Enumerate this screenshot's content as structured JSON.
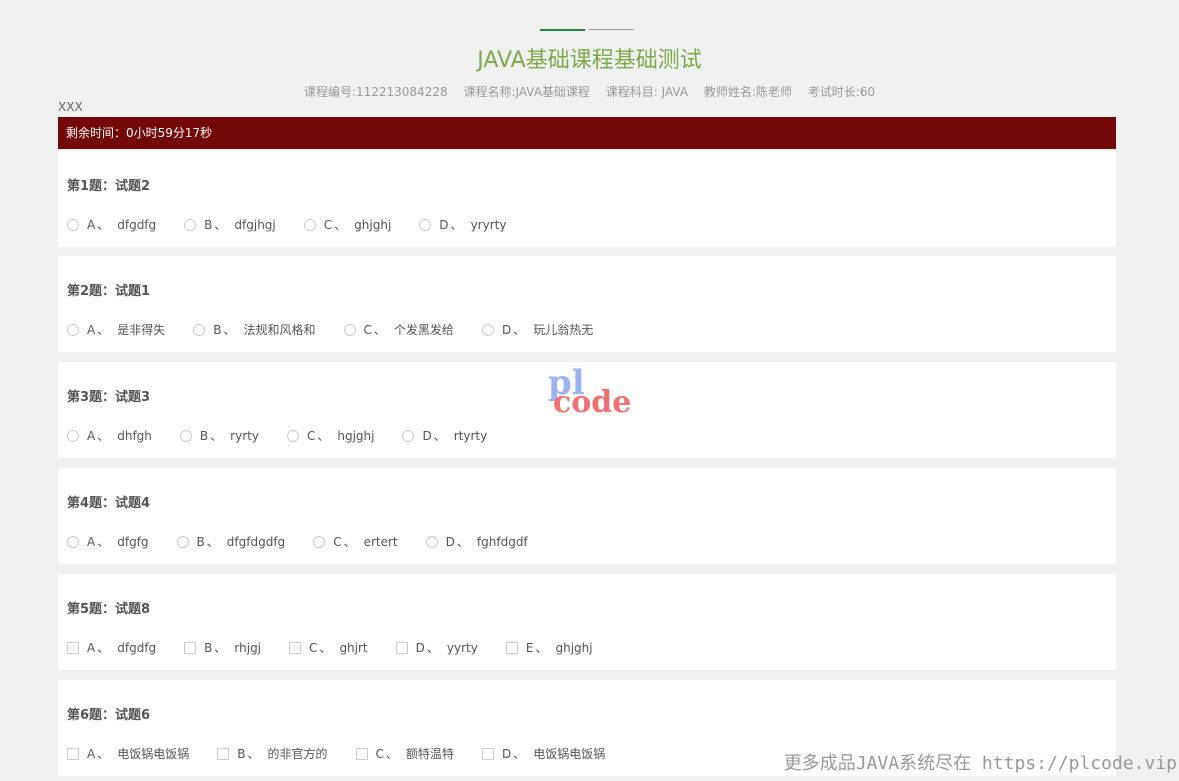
{
  "header": {
    "title": "JAVA基础课程基础测试",
    "meta": [
      "课程编号:112213084228",
      "课程名称:JAVA基础课程",
      "课程科目: JAVA",
      "教师姓名:陈老师",
      "考试时长:60"
    ],
    "user": "XXX"
  },
  "timer": "剩余时间：0小时59分17秒",
  "questions": [
    {
      "title": "第1题：试题2",
      "type": "radio",
      "options": [
        {
          "letter": "A",
          "text": "dfgdfg"
        },
        {
          "letter": "B",
          "text": "dfgjhgj"
        },
        {
          "letter": "C",
          "text": "ghjghj"
        },
        {
          "letter": "D",
          "text": "yryrty"
        }
      ]
    },
    {
      "title": "第2题：试题1",
      "type": "radio",
      "options": [
        {
          "letter": "A",
          "text": "是非得失"
        },
        {
          "letter": "B",
          "text": "法规和风格和"
        },
        {
          "letter": "C",
          "text": "个发黑发给"
        },
        {
          "letter": "D",
          "text": "玩儿翁热无"
        }
      ]
    },
    {
      "title": "第3题：试题3",
      "type": "radio",
      "options": [
        {
          "letter": "A",
          "text": "dhfgh"
        },
        {
          "letter": "B",
          "text": "ryrty"
        },
        {
          "letter": "C",
          "text": "hgjghj"
        },
        {
          "letter": "D",
          "text": "rtyrty"
        }
      ]
    },
    {
      "title": "第4题：试题4",
      "type": "radio",
      "options": [
        {
          "letter": "A",
          "text": "dfgfg"
        },
        {
          "letter": "B",
          "text": "dfgfdgdfg"
        },
        {
          "letter": "C",
          "text": "ertert"
        },
        {
          "letter": "D",
          "text": "fghfdgdf"
        }
      ]
    },
    {
      "title": "第5题：试题8",
      "type": "checkbox",
      "options": [
        {
          "letter": "A",
          "text": "dfgdfg"
        },
        {
          "letter": "B",
          "text": "rhjgj"
        },
        {
          "letter": "C",
          "text": "ghjrt"
        },
        {
          "letter": "D",
          "text": "yyrty"
        },
        {
          "letter": "E",
          "text": "ghjghj"
        }
      ]
    },
    {
      "title": "第6题：试题6",
      "type": "checkbox",
      "options": [
        {
          "letter": "A",
          "text": "电饭锅电饭锅"
        },
        {
          "letter": "B",
          "text": "的非官方的"
        },
        {
          "letter": "C",
          "text": "额特温特"
        },
        {
          "letter": "D",
          "text": "电饭锅电饭锅"
        }
      ]
    }
  ],
  "option_separator": "、",
  "watermark": {
    "line1": "pl",
    "line2": "code"
  },
  "footer_watermark": "更多成品JAVA系统尽在 https://plcode.vip",
  "colors": {
    "title": "#7cab4a",
    "timer_bg": "#740707",
    "accent_line": "#1e8a3c"
  }
}
